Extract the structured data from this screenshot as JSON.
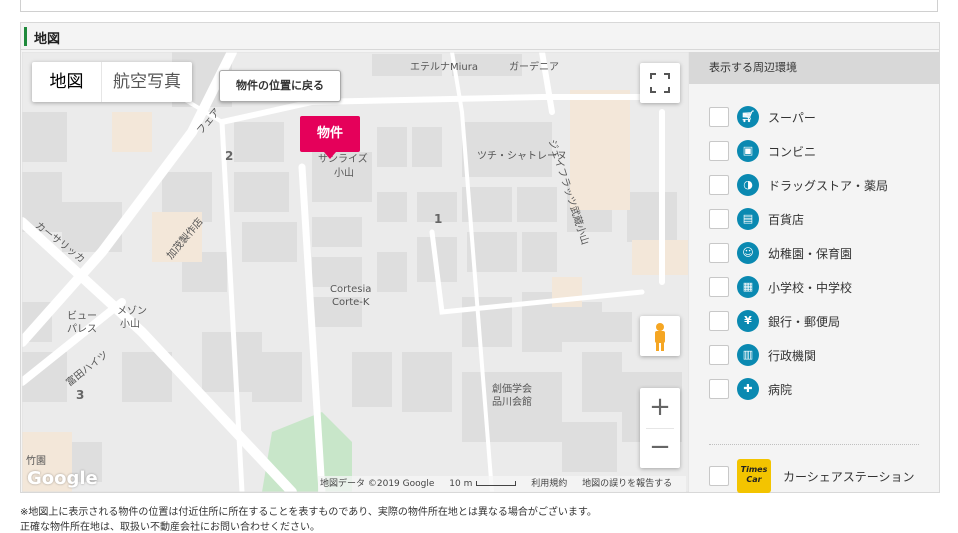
{
  "section": {
    "title": "地図"
  },
  "map": {
    "type_map": "地図",
    "type_satellite": "航空写真",
    "back_button": "物件の位置に戻る",
    "pin_label": "物件",
    "attribution": {
      "data": "地図データ ©2019 Google",
      "scale": "10 m",
      "terms": "利用規約",
      "report": "地図の誤りを報告する"
    },
    "logo": "Google",
    "labels": {
      "eterna": "エテルナMiura",
      "gardenia": "ガーデニア",
      "sunrise": "サンライズ",
      "koyama": "小山",
      "tsuchi": "ツチ・シャトレーヌ",
      "jfrac": "ジェイフラッツ武蔵小山",
      "carsarikka": "カーサリッカ",
      "kamo": "加茂製作店",
      "view": "ビュー",
      "palace": "パレス",
      "meson": "メゾン",
      "meson_koyama": "小山",
      "cortesia": "Cortesia",
      "cortek": "Corte-K",
      "tomita": "富田ハイツ",
      "soka1": "創価学会",
      "soka2": "品川会館",
      "fair": "フェア",
      "takehara": "竹園",
      "num1": "1",
      "num2": "2",
      "num3": "3"
    }
  },
  "sidebar": {
    "header": "表示する周辺環境",
    "options": [
      {
        "label": "スーパー",
        "icon": "cart-icon"
      },
      {
        "label": "コンビニ",
        "icon": "convenience-icon"
      },
      {
        "label": "ドラッグストア・薬局",
        "icon": "pill-icon"
      },
      {
        "label": "百貨店",
        "icon": "department-store-icon"
      },
      {
        "label": "幼稚園・保育園",
        "icon": "kindergarten-icon"
      },
      {
        "label": "小学校・中学校",
        "icon": "school-icon"
      },
      {
        "label": "銀行・郵便局",
        "icon": "bank-icon"
      },
      {
        "label": "行政機関",
        "icon": "government-icon"
      },
      {
        "label": "病院",
        "icon": "hospital-icon"
      }
    ],
    "carshare": {
      "label": "カーシェアステーション",
      "logo_text": "Times Car PLUS"
    }
  },
  "notes": {
    "line1": "※地図上に表示される物件の位置は付近住所に所在することを表すものであり、実際の物件所在地とは異なる場合がございます。",
    "line2": "正確な物件所在地は、取扱い不動産会社にお問い合わせください。"
  },
  "colors": {
    "accent": "#1f8a3c",
    "pin": "#e5005a",
    "poi": "#0a89b1",
    "times": "#f3c400"
  }
}
